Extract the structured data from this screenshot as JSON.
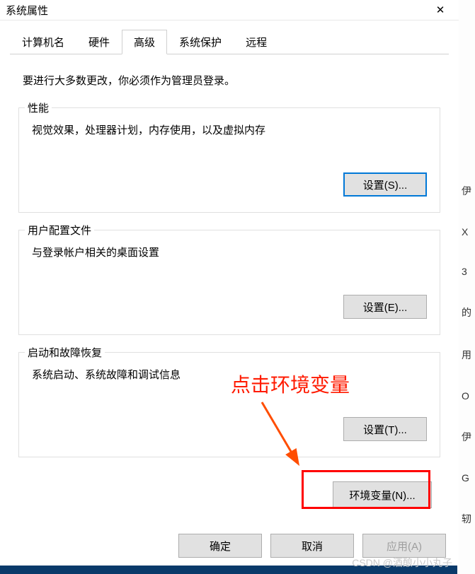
{
  "titlebar": {
    "title": "系统属性"
  },
  "tabs": [
    {
      "label": "计算机名"
    },
    {
      "label": "硬件"
    },
    {
      "label": "高级",
      "active": true
    },
    {
      "label": "系统保护"
    },
    {
      "label": "远程"
    }
  ],
  "intro": "要进行大多数更改，你必须作为管理员登录。",
  "groups": {
    "performance": {
      "title": "性能",
      "desc": "视觉效果，处理器计划，内存使用，以及虚拟内存",
      "btn": "设置(S)..."
    },
    "profiles": {
      "title": "用户配置文件",
      "desc": "与登录帐户相关的桌面设置",
      "btn": "设置(E)..."
    },
    "startup": {
      "title": "启动和故障恢复",
      "desc": "系统启动、系统故障和调试信息",
      "btn": "设置(T)..."
    }
  },
  "env_button": "环境变量(N)...",
  "footer": {
    "ok": "确定",
    "cancel": "取消",
    "apply": "应用(A)"
  },
  "annotation": "点击环境变量",
  "watermark": "CSDN @酒酿小小丸子",
  "strip": [
    "伊",
    "X",
    "3",
    "的",
    "用",
    "O",
    "伊",
    "G",
    "轫"
  ]
}
